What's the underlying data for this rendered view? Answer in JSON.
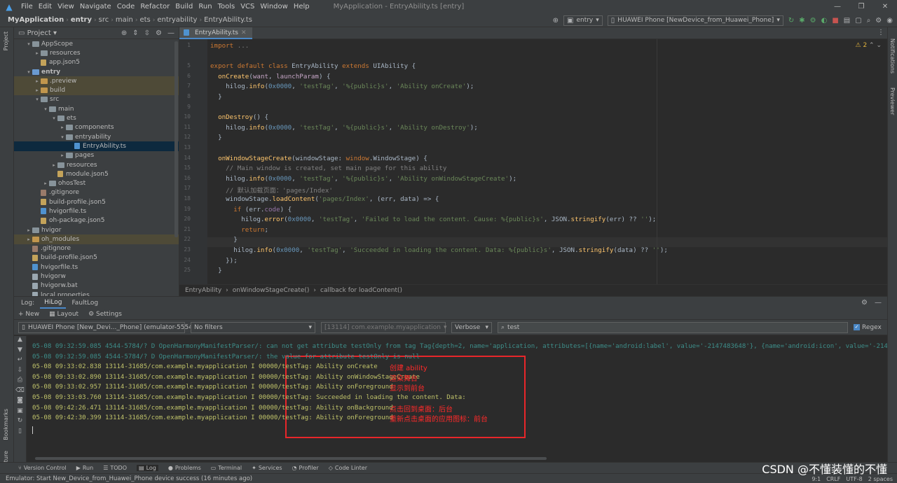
{
  "menubar": {
    "items": [
      "File",
      "Edit",
      "View",
      "Navigate",
      "Code",
      "Refactor",
      "Build",
      "Run",
      "Tools",
      "VCS",
      "Window",
      "Help"
    ],
    "window_title": "MyApplication - EntryAbility.ts [entry]"
  },
  "navbar": {
    "crumbs": [
      "MyApplication",
      "entry",
      "src",
      "main",
      "ets",
      "entryability",
      "EntryAbility.ts"
    ],
    "module_combo": "entry",
    "device_combo": "HUAWEI Phone [NewDevice_from_Huawei_Phone]"
  },
  "project": {
    "title": "Project",
    "tree": [
      {
        "label": "AppScope",
        "kind": "folder",
        "depth": 1,
        "open": true
      },
      {
        "label": "resources",
        "kind": "folder",
        "depth": 2,
        "open": false
      },
      {
        "label": "app.json5",
        "kind": "json",
        "depth": 2
      },
      {
        "label": "entry",
        "kind": "folder-blue",
        "depth": 1,
        "open": true,
        "bold": true
      },
      {
        "label": ".preview",
        "kind": "folder-orange",
        "depth": 2,
        "open": false,
        "hl": true
      },
      {
        "label": "build",
        "kind": "folder-orange",
        "depth": 2,
        "open": false,
        "hl": true
      },
      {
        "label": "src",
        "kind": "folder",
        "depth": 2,
        "open": true
      },
      {
        "label": "main",
        "kind": "folder",
        "depth": 3,
        "open": true
      },
      {
        "label": "ets",
        "kind": "folder",
        "depth": 4,
        "open": true
      },
      {
        "label": "components",
        "kind": "folder",
        "depth": 5,
        "open": false
      },
      {
        "label": "entryability",
        "kind": "folder",
        "depth": 5,
        "open": true
      },
      {
        "label": "EntryAbility.ts",
        "kind": "ts",
        "depth": 6,
        "sel": true
      },
      {
        "label": "pages",
        "kind": "folder",
        "depth": 5,
        "open": false
      },
      {
        "label": "resources",
        "kind": "folder",
        "depth": 4,
        "open": false
      },
      {
        "label": "module.json5",
        "kind": "json",
        "depth": 4
      },
      {
        "label": "ohosTest",
        "kind": "folder",
        "depth": 3,
        "open": false
      },
      {
        "label": ".gitignore",
        "kind": "git",
        "depth": 2
      },
      {
        "label": "build-profile.json5",
        "kind": "json",
        "depth": 2
      },
      {
        "label": "hvigorfile.ts",
        "kind": "ts",
        "depth": 2
      },
      {
        "label": "oh-package.json5",
        "kind": "json",
        "depth": 2
      },
      {
        "label": "hvigor",
        "kind": "folder",
        "depth": 1,
        "open": false
      },
      {
        "label": "oh_modules",
        "kind": "folder-orange",
        "depth": 1,
        "open": false,
        "hl": true
      },
      {
        "label": ".gitignore",
        "kind": "git",
        "depth": 1
      },
      {
        "label": "build-profile.json5",
        "kind": "json",
        "depth": 1
      },
      {
        "label": "hvigorfile.ts",
        "kind": "ts",
        "depth": 1
      },
      {
        "label": "hvigorw",
        "kind": "file",
        "depth": 1
      },
      {
        "label": "hvigorw.bat",
        "kind": "file",
        "depth": 1
      },
      {
        "label": "local.properties",
        "kind": "file",
        "depth": 1
      }
    ]
  },
  "editor": {
    "tab": "EntryAbility.ts",
    "warnings": "2",
    "line_numbers": [
      "1",
      "",
      "5",
      "6",
      "7",
      "8",
      "9",
      "10",
      "11",
      "12",
      "13",
      "14",
      "15",
      "16",
      "17",
      "18",
      "19",
      "20",
      "21",
      "22",
      "23",
      "24",
      "25"
    ],
    "lines": [
      [
        [
          "kw",
          "import "
        ],
        [
          "cm",
          "..."
        ]
      ],
      [],
      [
        [
          "kw",
          "export default class "
        ],
        [
          "id",
          "EntryAbility "
        ],
        [
          "kw",
          "extends "
        ],
        [
          "id",
          "UIAbility {"
        ]
      ],
      [
        [
          "fn",
          "  onCreate"
        ],
        [
          "id",
          "("
        ],
        [
          "par",
          "want"
        ],
        [
          "id",
          ", "
        ],
        [
          "par",
          "launchParam"
        ],
        [
          "id",
          ") {"
        ]
      ],
      [
        [
          "id",
          "    hilog."
        ],
        [
          "fn",
          "info"
        ],
        [
          "id",
          "("
        ],
        [
          "num",
          "0x0000"
        ],
        [
          "id",
          ", "
        ],
        [
          "str",
          "'testTag'"
        ],
        [
          "id",
          ", "
        ],
        [
          "str",
          "'%{public}s'"
        ],
        [
          "id",
          ", "
        ],
        [
          "str",
          "'Ability onCreate'"
        ],
        [
          "id",
          ");"
        ]
      ],
      [
        [
          "id",
          "  }"
        ]
      ],
      [],
      [
        [
          "fn",
          "  onDestroy"
        ],
        [
          "id",
          "() {"
        ]
      ],
      [
        [
          "id",
          "    hilog."
        ],
        [
          "fn",
          "info"
        ],
        [
          "id",
          "("
        ],
        [
          "num",
          "0x0000"
        ],
        [
          "id",
          ", "
        ],
        [
          "str",
          "'testTag'"
        ],
        [
          "id",
          ", "
        ],
        [
          "str",
          "'%{public}s'"
        ],
        [
          "id",
          ", "
        ],
        [
          "str",
          "'Ability onDestroy'"
        ],
        [
          "id",
          ");"
        ]
      ],
      [
        [
          "id",
          "  }"
        ]
      ],
      [],
      [
        [
          "fn",
          "  onWindowStageCreate"
        ],
        [
          "id",
          "(windowStage: "
        ],
        [
          "kw",
          "window"
        ],
        [
          "id",
          ".WindowStage) {"
        ]
      ],
      [
        [
          "cm",
          "    // Main window is created, set main page for this ability"
        ]
      ],
      [
        [
          "id",
          "    hilog."
        ],
        [
          "fn",
          "info"
        ],
        [
          "id",
          "("
        ],
        [
          "num",
          "0x0000"
        ],
        [
          "id",
          ", "
        ],
        [
          "str",
          "'testTag'"
        ],
        [
          "id",
          ", "
        ],
        [
          "str",
          "'%{public}s'"
        ],
        [
          "id",
          ", "
        ],
        [
          "str",
          "'Ability onWindowStageCreate'"
        ],
        [
          "id",
          ");"
        ]
      ],
      [
        [
          "cm",
          "    // 默认加载页面：'pages/Index'"
        ]
      ],
      [
        [
          "id",
          "    windowStage."
        ],
        [
          "fn",
          "loadContent"
        ],
        [
          "id",
          "("
        ],
        [
          "str",
          "'pages/Index'"
        ],
        [
          "id",
          ", (err, data) => {"
        ]
      ],
      [
        [
          "kw",
          "      if "
        ],
        [
          "id",
          "(err."
        ],
        [
          "prop",
          "code"
        ],
        [
          "id",
          ") {"
        ]
      ],
      [
        [
          "id",
          "        hilog."
        ],
        [
          "fn",
          "error"
        ],
        [
          "id",
          "("
        ],
        [
          "num",
          "0x0000"
        ],
        [
          "id",
          ", "
        ],
        [
          "str",
          "'testTag'"
        ],
        [
          "id",
          ", "
        ],
        [
          "str",
          "'Failed to load the content. Cause: %{public}s'"
        ],
        [
          "id",
          ", JSON."
        ],
        [
          "fn",
          "stringify"
        ],
        [
          "id",
          "(err) ?? "
        ],
        [
          "str",
          "''"
        ],
        [
          "id",
          ");"
        ]
      ],
      [
        [
          "kw",
          "        return"
        ],
        [
          "id",
          ";"
        ]
      ],
      [
        [
          "id",
          "      }"
        ]
      ],
      [
        [
          "id",
          "      hilog."
        ],
        [
          "fn",
          "info"
        ],
        [
          "id",
          "("
        ],
        [
          "num",
          "0x0000"
        ],
        [
          "id",
          ", "
        ],
        [
          "str",
          "'testTag'"
        ],
        [
          "id",
          ", "
        ],
        [
          "str",
          "'Succeeded in loading the content. Data: %{public}s'"
        ],
        [
          "id",
          ", JSON."
        ],
        [
          "fn",
          "stringify"
        ],
        [
          "id",
          "(data) ?? "
        ],
        [
          "str",
          "''"
        ],
        [
          "id",
          ");"
        ]
      ],
      [
        [
          "id",
          "    });"
        ]
      ],
      [
        [
          "id",
          "  }"
        ]
      ]
    ],
    "breadcrumb": [
      "EntryAbility",
      "onWindowStageCreate()",
      "callback for loadContent()"
    ]
  },
  "log": {
    "label": "Log:",
    "tabs": [
      "HiLog",
      "FaultLog"
    ],
    "toolbar": [
      "New",
      "Layout",
      "Settings"
    ],
    "device": "HUAWEI Phone [New_Devi..._Phone] (emulator-5554)",
    "filter": "No filters",
    "process": "[13114] com.example.myapplication",
    "level": "Verbose",
    "search": "test",
    "regex_label": "Regex",
    "lines": [
      {
        "type": "d",
        "text": "05-08 09:32:59.085 4544-5784/? D OpenHarmonyManifestParser/: can not get attribute testOnly from tag Tag{depth=2, name='application, attributes=[{name='android:label', value='-2147483648'}, {name='android:icon', value='-2147483647"
      },
      {
        "type": "d",
        "text": "05-08 09:32:59.085 4544-5784/? D OpenHarmonyManifestParser/: the value for attribute testOnly is null"
      },
      {
        "type": "i",
        "text": "05-08 09:33:02.838 13114-31685/com.example.myapplication I 00000/testTag: Ability onCreate"
      },
      {
        "type": "i",
        "text": "05-08 09:33:02.890 13114-31685/com.example.myapplication I 00000/testTag: Ability onWindowStageCreate"
      },
      {
        "type": "i",
        "text": "05-08 09:33:02.957 13114-31685/com.example.myapplication I 00000/testTag: Ability onForeground"
      },
      {
        "type": "i",
        "text": "05-08 09:33:03.760 13114-31685/com.example.myapplication I 00000/testTag: Succeeded in loading the content. Data:"
      },
      {
        "type": "i",
        "text": "05-08 09:42:26.471 13114-31685/com.example.myapplication I 00000/testTag: Ability onBackground"
      },
      {
        "type": "i",
        "text": "05-08 09:42:30.399 13114-31685/com.example.myapplication I 00000/testTag: Ability onForeground"
      }
    ],
    "annotations": [
      "创建 ability",
      "渲染舞台",
      "显示到前台",
      "",
      "点击回到桌面：后台",
      "重新点击桌面的应用图标：前台"
    ]
  },
  "sidebars": {
    "left": [
      "Project",
      "Bookmarks",
      "Structure"
    ],
    "right": [
      "Notifications",
      "Previewer"
    ]
  },
  "toolwindows": [
    "Version Control",
    "Run",
    "TODO",
    "Log",
    "Problems",
    "Terminal",
    "Services",
    "Profiler",
    "Code Linter"
  ],
  "status": {
    "message": "Emulator: Start New_Device_from_Huawei_Phone device success (16 minutes ago)",
    "position": "9:1",
    "line_sep": "CRLF",
    "encoding": "UTF-8",
    "indent": "2 spaces"
  },
  "watermark": "CSDN @不懂装懂的不懂"
}
